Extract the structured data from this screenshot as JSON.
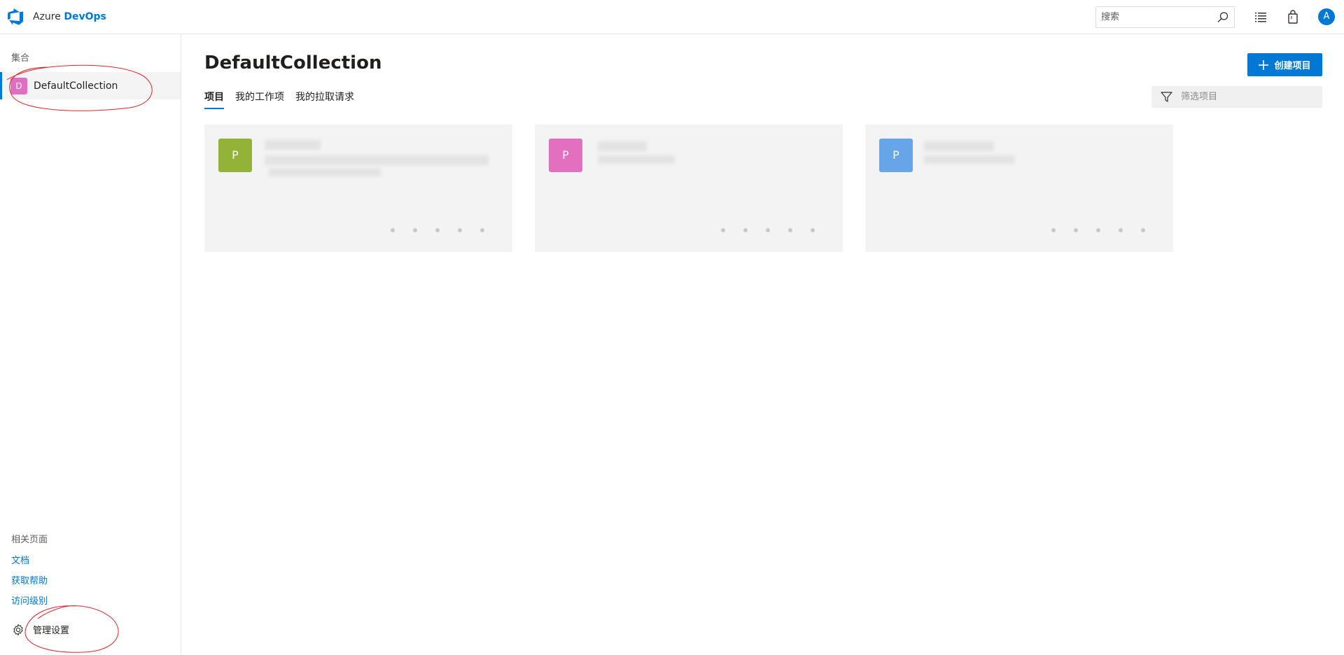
{
  "header": {
    "brand_prefix": "Azure",
    "brand_suffix": "DevOps",
    "search_placeholder": "搜索",
    "user_initial": "A"
  },
  "sidebar": {
    "collections_heading": "集合",
    "collection": {
      "initial": "D",
      "label": "DefaultCollection",
      "color": "#e06fc3"
    },
    "related_heading": "相关页面",
    "links": [
      "文档",
      "获取帮助",
      "访问级别"
    ],
    "admin_label": "管理设置"
  },
  "main": {
    "title": "DefaultCollection",
    "create_label": "创建项目",
    "tabs": [
      {
        "label": "项目",
        "active": true
      },
      {
        "label": "我的工作项",
        "active": false
      },
      {
        "label": "我的拉取请求",
        "active": false
      }
    ],
    "filter_placeholder": "筛选项目",
    "projects": [
      {
        "initial": "P",
        "color": "#93b338"
      },
      {
        "initial": "P",
        "color": "#e36fc1"
      },
      {
        "initial": "P",
        "color": "#68a5e8"
      }
    ]
  },
  "colors": {
    "accent": "#0078d4",
    "annotation": "#e0242a"
  }
}
